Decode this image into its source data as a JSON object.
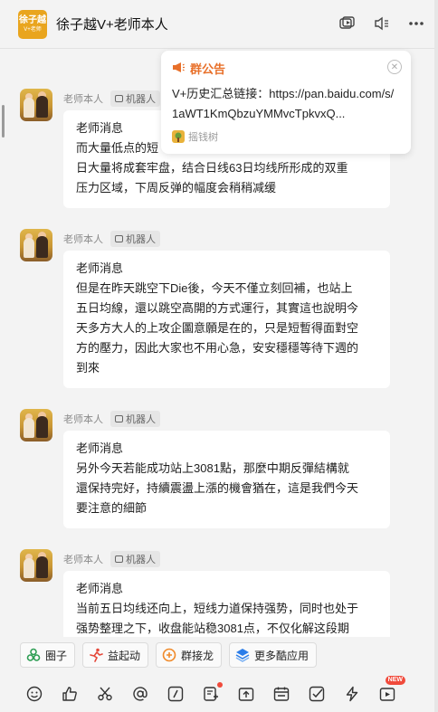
{
  "window": {
    "title": "徐子越V+老师本人",
    "logo_text_top": "徐子越",
    "logo_text_bottom": "V+老师"
  },
  "announcement": {
    "title": "群公告",
    "body": "V+历史汇总链接：https://pan.baidu.com/s/1aWT1KmQbzuYMMvcTpkvxQ...",
    "source": "摇钱树"
  },
  "messages": [
    {
      "sender": "老师本人",
      "tag": "机器人",
      "lines": [
        "老师消息",
        "而大量低点的短",
        "日大量将成套牢盘，结合日线63日均线所形成的双重",
        "压力区域，下周反弹的幅度会稍稍减缓"
      ]
    },
    {
      "sender": "老师本人",
      "tag": "机器人",
      "lines": [
        "老师消息",
        "但是在昨天跳空下Die後，今天不僅立刻回補，也站上",
        "五日均線，還以跳空高開的方式運行，其實這也說明今",
        "天多方大人的上攻企圖意願是在的，只是短暫得面對空",
        "方的壓力，因此大家也不用心急，安安穩穩等待下週的",
        "到來"
      ]
    },
    {
      "sender": "老师本人",
      "tag": "机器人",
      "lines": [
        "老师消息",
        "另外今天若能成功站上3081點，那麼中期反彈結構就",
        "還保持完好，持續震盪上漲的機會猶在，這是我們今天",
        "要注意的細節"
      ]
    },
    {
      "sender": "老师本人",
      "tag": "机器人",
      "lines": [
        "老师消息",
        "当前五日均线还向上，短线力道保持强势，同时也处于",
        "强势整理之下，收盘能站稳3081点，不仅化解这段期"
      ]
    }
  ],
  "apps": [
    {
      "label": "圈子",
      "icon": "circle-app-icon"
    },
    {
      "label": "益起动",
      "icon": "run-app-icon"
    },
    {
      "label": "群接龙",
      "icon": "relay-app-icon"
    },
    {
      "label": "更多酷应用",
      "icon": "more-apps-icon"
    }
  ],
  "toolbar": {
    "new_label": "NEW"
  },
  "colors": {
    "accent_orange": "#e8702a",
    "logo_bg": "#e9a51e",
    "badge_red": "#f04a3b"
  }
}
